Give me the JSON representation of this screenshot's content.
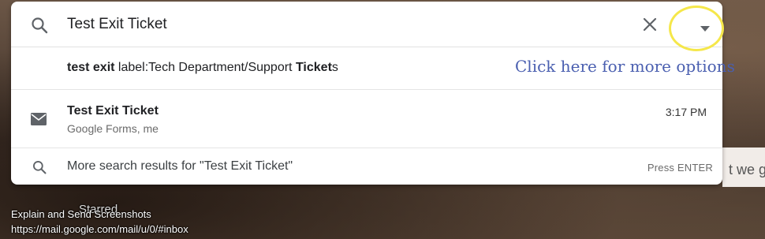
{
  "search": {
    "query": "Test Exit Ticket",
    "icons": {
      "search": "search-icon",
      "close": "close-icon",
      "dropdown": "caret-down-icon"
    }
  },
  "suggestion": {
    "bold1": "test exit",
    "plain1": " label:Tech Department/Support ",
    "bold2": "Ticket",
    "plain2": "s"
  },
  "callout": {
    "text": "Click here for more options",
    "color": "#4a5fb0",
    "ring_color": "#f5e74a"
  },
  "email": {
    "icon": "mail-icon",
    "subject": "Test Exit Ticket",
    "from": "Google Forms, me",
    "time": "3:17 PM"
  },
  "more_results": {
    "text": "More search results for \"Test Exit Ticket\"",
    "hint": "Press ENTER"
  },
  "background": {
    "partial_text": "t we ge"
  },
  "overlay": {
    "main": "Explain and Send Screenshots",
    "ghost": "Starred",
    "url": "https://mail.google.com/mail/u/0/#inbox"
  }
}
